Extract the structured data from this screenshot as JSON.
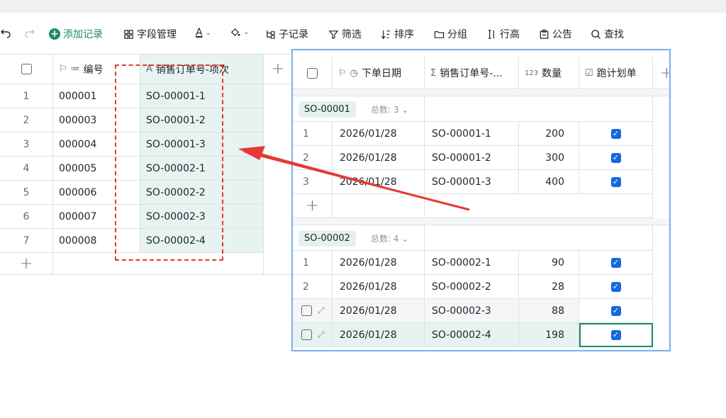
{
  "toolbar": {
    "add_record": "添加记录",
    "field_manage": "字段管理",
    "text_color": "A",
    "sub_record": "子记录",
    "filter": "筛选",
    "sort": "排序",
    "group": "分组",
    "row_height": "行高",
    "notice": "公告",
    "search": "查找"
  },
  "left_table": {
    "columns": [
      "编号",
      "销售订单号-项次"
    ],
    "rows": [
      {
        "n": "1",
        "id": "000001",
        "so": "SO-00001-1"
      },
      {
        "n": "2",
        "id": "000003",
        "so": "SO-00001-2"
      },
      {
        "n": "3",
        "id": "000004",
        "so": "SO-00001-3"
      },
      {
        "n": "4",
        "id": "000005",
        "so": "SO-00002-1"
      },
      {
        "n": "5",
        "id": "000006",
        "so": "SO-00002-2"
      },
      {
        "n": "6",
        "id": "000007",
        "so": "SO-00002-3"
      },
      {
        "n": "7",
        "id": "000008",
        "so": "SO-00002-4"
      }
    ]
  },
  "right_table": {
    "columns": [
      "下单日期",
      "销售订单号-...",
      "数量",
      "跑计划单"
    ],
    "qty_icon": "123",
    "groups": [
      {
        "tag": "SO-00001",
        "count": "总数: 3",
        "rows": [
          {
            "n": "1",
            "date": "2026/01/28",
            "so": "SO-00001-1",
            "qty": "200"
          },
          {
            "n": "2",
            "date": "2026/01/28",
            "so": "SO-00001-2",
            "qty": "300"
          },
          {
            "n": "3",
            "date": "2026/01/28",
            "so": "SO-00001-3",
            "qty": "400"
          }
        ]
      },
      {
        "tag": "SO-00002",
        "count": "总数: 4",
        "rows": [
          {
            "n": "1",
            "date": "2026/01/28",
            "so": "SO-00002-1",
            "qty": "90"
          },
          {
            "n": "2",
            "date": "2026/01/28",
            "so": "SO-00002-2",
            "qty": "28"
          },
          {
            "n": "",
            "date": "2026/01/28",
            "so": "SO-00002-3",
            "qty": "88"
          },
          {
            "n": "",
            "date": "2026/01/28",
            "so": "SO-00002-4",
            "qty": "198"
          }
        ]
      }
    ]
  },
  "colors": {
    "accent": "#1a8a6a",
    "highlight": "#e7f3f0",
    "annotation": "#e53935",
    "panel_border": "#79aef0"
  }
}
